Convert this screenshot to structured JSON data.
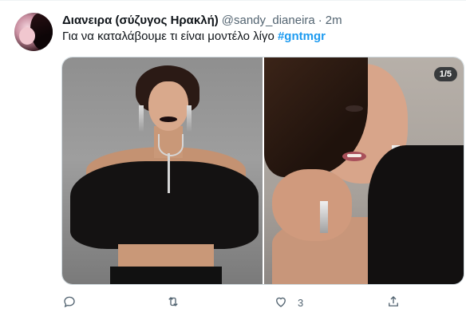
{
  "tweet": {
    "display_name": "Διανειρα (σύζυγος Ηρακλή)",
    "handle": "@sandy_dianeira",
    "separator": "·",
    "time": "2m",
    "text": "Για να καταλάβουμε τι είναι μοντέλο λίγο",
    "hashtag": "#gntmgr"
  },
  "media": {
    "counter": "1/5"
  },
  "actions": {
    "reply_count": "",
    "retweet_count": "",
    "like_count": "3"
  },
  "colors": {
    "accent": "#1d9bf0",
    "text_primary": "#0f1419",
    "text_secondary": "#536471",
    "border": "#cfd9de"
  },
  "icons": {
    "reply": "reply-bubble-icon",
    "retweet": "retweet-icon",
    "like": "heart-icon",
    "share": "share-icon",
    "more": "more-horizontal-icon"
  }
}
